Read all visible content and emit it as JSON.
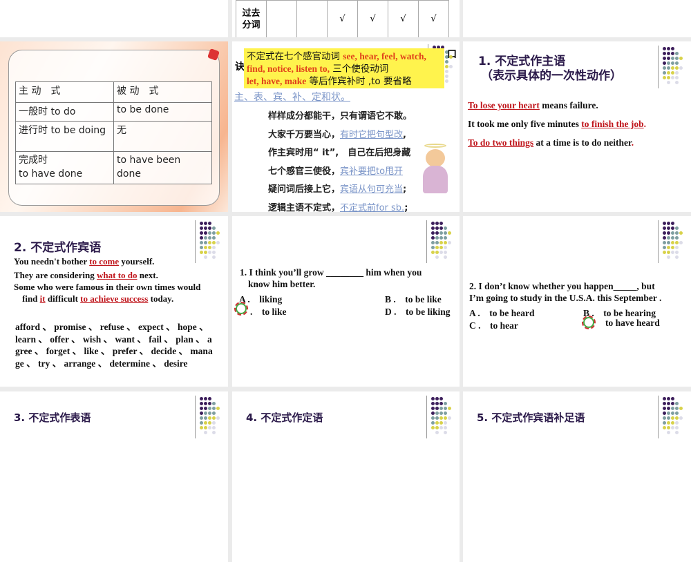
{
  "slide_top": {
    "row_label": "过去\n分词",
    "checks": [
      "",
      "",
      "√",
      "√",
      "√",
      "√"
    ]
  },
  "slide_table": {
    "headers": [
      "主 动　式",
      "被 动　式"
    ],
    "rows": [
      [
        "一般时 to do",
        "to be done"
      ],
      [
        "进行时 to be doing",
        "无"
      ],
      [
        "完成时\nto have done",
        "to have been\ndone"
      ]
    ]
  },
  "slide_poem": {
    "bubble": {
      "l1a": "不定式在七个感官动词 ",
      "l1b": "see, hear, feel, watch,",
      "l2a": "find, notice, listen to,",
      "l2b": " 三个使役动词",
      "l3a": "let, have, make",
      "l3b": " 等后作宾补时 ,to 要省略"
    },
    "behind_left": "诀",
    "behind_right": "口",
    "line0": "主、表、宾、补、定和状。",
    "lines": [
      [
        "样样成分都能干，只有谓语它不敢。",
        ""
      ],
      [
        "大家千万要当心，",
        "有时它把句型改"
      ],
      [
        "作主宾时用“ it”,　自己在后把身藏",
        ""
      ],
      [
        "七个感官三使役，",
        "宾补要把to甩开"
      ],
      [
        "疑问词后接上它，",
        "宾语从句可充当"
      ],
      [
        "逻辑主语不定式，",
        "不定式前for sb."
      ]
    ],
    "ends": [
      "",
      ",",
      "",
      "",
      ";",
      ";"
    ]
  },
  "slide_subject": {
    "title1": "1. 不定式作主语",
    "title2": "（表示具体的一次性动作）",
    "s1": [
      "To lose your heart",
      " means failure."
    ],
    "s2": [
      "It took me only five minutes ",
      "to finish the job",
      "."
    ],
    "s3": [
      "To do two things",
      " at a time is to do neither",
      ". "
    ]
  },
  "slide_object": {
    "title": "2. 不定式作宾语",
    "s1": [
      "You needn't bother ",
      "to come",
      " yourself."
    ],
    "s2": [
      "They are considering ",
      "what to do",
      " next."
    ],
    "s3": [
      "Some who were famous in their own times would"
    ],
    "s4": [
      "find ",
      "it",
      " difficult ",
      "to achieve success",
      " today."
    ],
    "verbs": "afford 、 promise 、 refuse 、 expect 、 hope 、 learn 、 offer 、 wish 、 want 、 fail 、 plan 、 agree 、 forget 、 like 、 prefer 、 decide 、 manage 、 try 、 arrange 、 determine 、 desire"
  },
  "slide_q1": {
    "q": "1. I think you’ll grow ________ him when you",
    "q2": "know him better.",
    "a": "A .　liking",
    "b": "B .　to be like",
    "c": ".　to like",
    "d": "D .　to be liking"
  },
  "slide_q2": {
    "q": "2. I don’t know whether you happen_____, but",
    "q2": "I’m going to study in the U.S.A. this September .",
    "a": "A .　to be heard",
    "b": "B .　to be hearing",
    "c": "C .　to hear",
    "d": "to have heard"
  },
  "slide_bottom": {
    "t1": "3. 不定式作表语",
    "t2": "4. 不定式作定语",
    "t3": "5. 不定式作宾语补足语"
  },
  "colors": {
    "accent_red": "#c0161c",
    "title": "#2b1a4a",
    "bubble": "#fff34d"
  }
}
